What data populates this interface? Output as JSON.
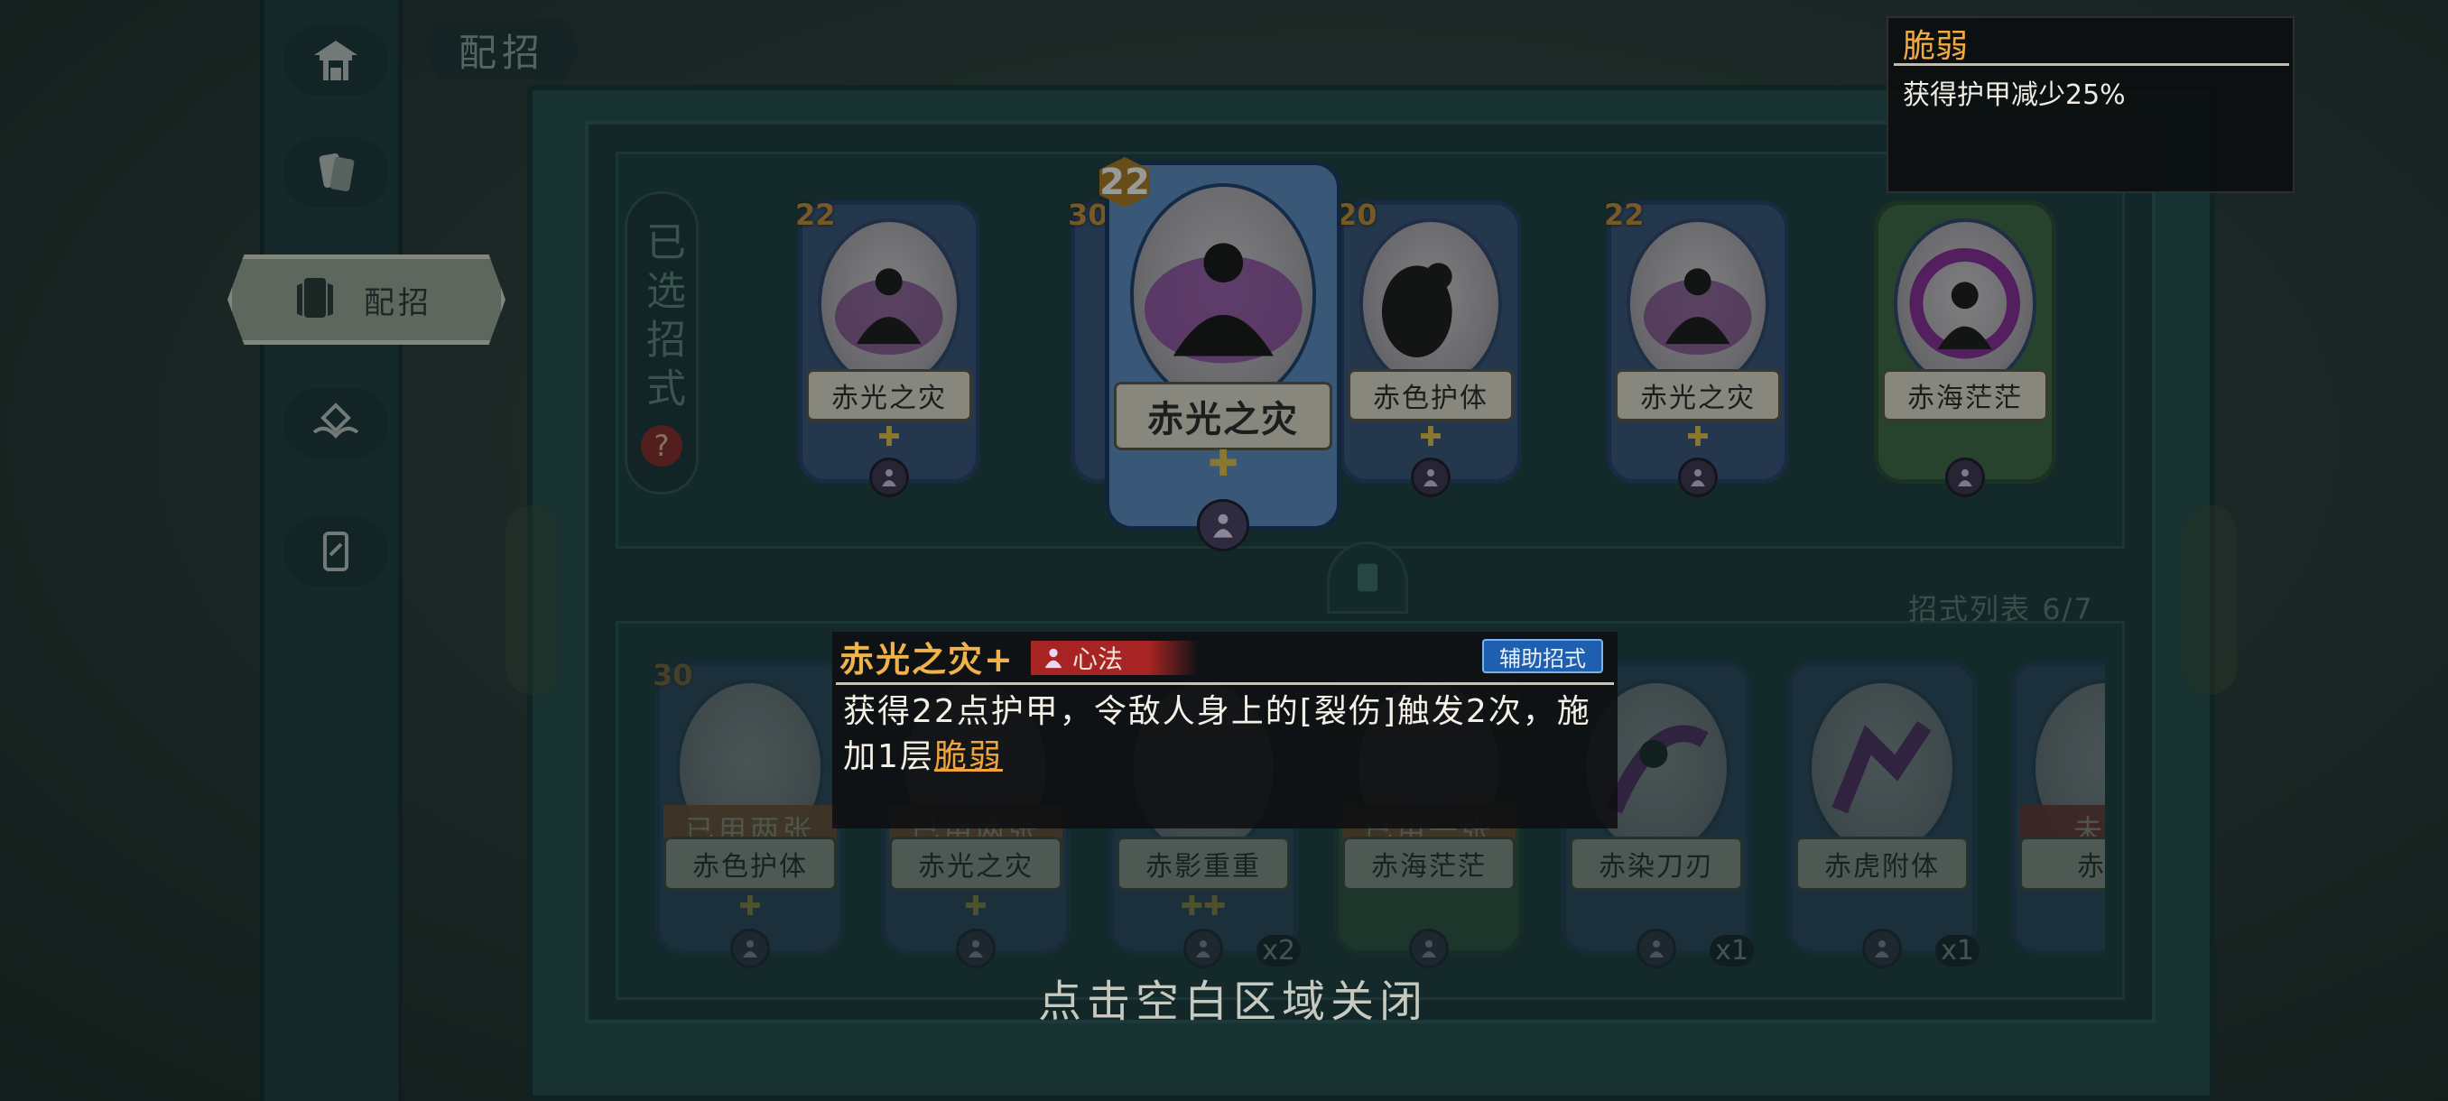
{
  "header": {
    "tab_title": "配招"
  },
  "nav": {
    "items": [
      {
        "name": "home",
        "icon": "pavilion-icon"
      },
      {
        "name": "cards",
        "icon": "cards-icon"
      },
      {
        "name": "peizhao",
        "icon": "deck-icon",
        "label": "配招",
        "active": true
      },
      {
        "name": "skills",
        "icon": "emblem-icon"
      },
      {
        "name": "card-single",
        "icon": "card-icon"
      }
    ]
  },
  "selected_section": {
    "label": "已选招式",
    "help": "?"
  },
  "selected_cards": [
    {
      "cost": "22",
      "name": "赤光之灾"
    },
    {
      "cost": "30",
      "name": ""
    },
    {
      "cost": "22",
      "name": "赤光之灾"
    },
    {
      "cost": "20",
      "name": "赤色护体"
    },
    {
      "cost": "22",
      "name": "赤光之灾"
    },
    {
      "cost": "",
      "name": "赤海茫茫"
    }
  ],
  "list_section": {
    "label": "招式列表",
    "count": "6/7"
  },
  "list_cards": [
    {
      "cost": "30",
      "name": "赤色护体",
      "tag": "已用两张",
      "qty": ""
    },
    {
      "cost": "",
      "name": "赤光之灾",
      "tag": "已用两张",
      "qty": ""
    },
    {
      "cost": "",
      "name": "赤影重重",
      "tag": "",
      "qty": "x2"
    },
    {
      "cost": "",
      "name": "赤海茫茫",
      "tag": "已用一张",
      "qty": ""
    },
    {
      "cost": "",
      "name": "赤染刀刃",
      "tag": "",
      "qty": "x1"
    },
    {
      "cost": "",
      "name": "赤虎附体",
      "tag": "",
      "qty": "x1"
    },
    {
      "cost": "",
      "name": "赤魔",
      "tag": "未习",
      "qty": ""
    }
  ],
  "detail": {
    "name": "赤光之灾+",
    "type": "心法",
    "badge": "辅助招式",
    "desc_main": "获得22点护甲，令敌人身上的[裂伤]触发2次，施加1层",
    "desc_keyword": "脆弱"
  },
  "tooltip": {
    "title": "脆弱",
    "desc": "获得护甲减少25%"
  },
  "close_hint": "点击空白区域关闭",
  "colors": {
    "panel": "#254a4d",
    "accent_gold": "#f0b24a",
    "card_blue": "#5d8dc4",
    "type_red": "#a82424",
    "badge_blue": "#1f5fb0"
  }
}
